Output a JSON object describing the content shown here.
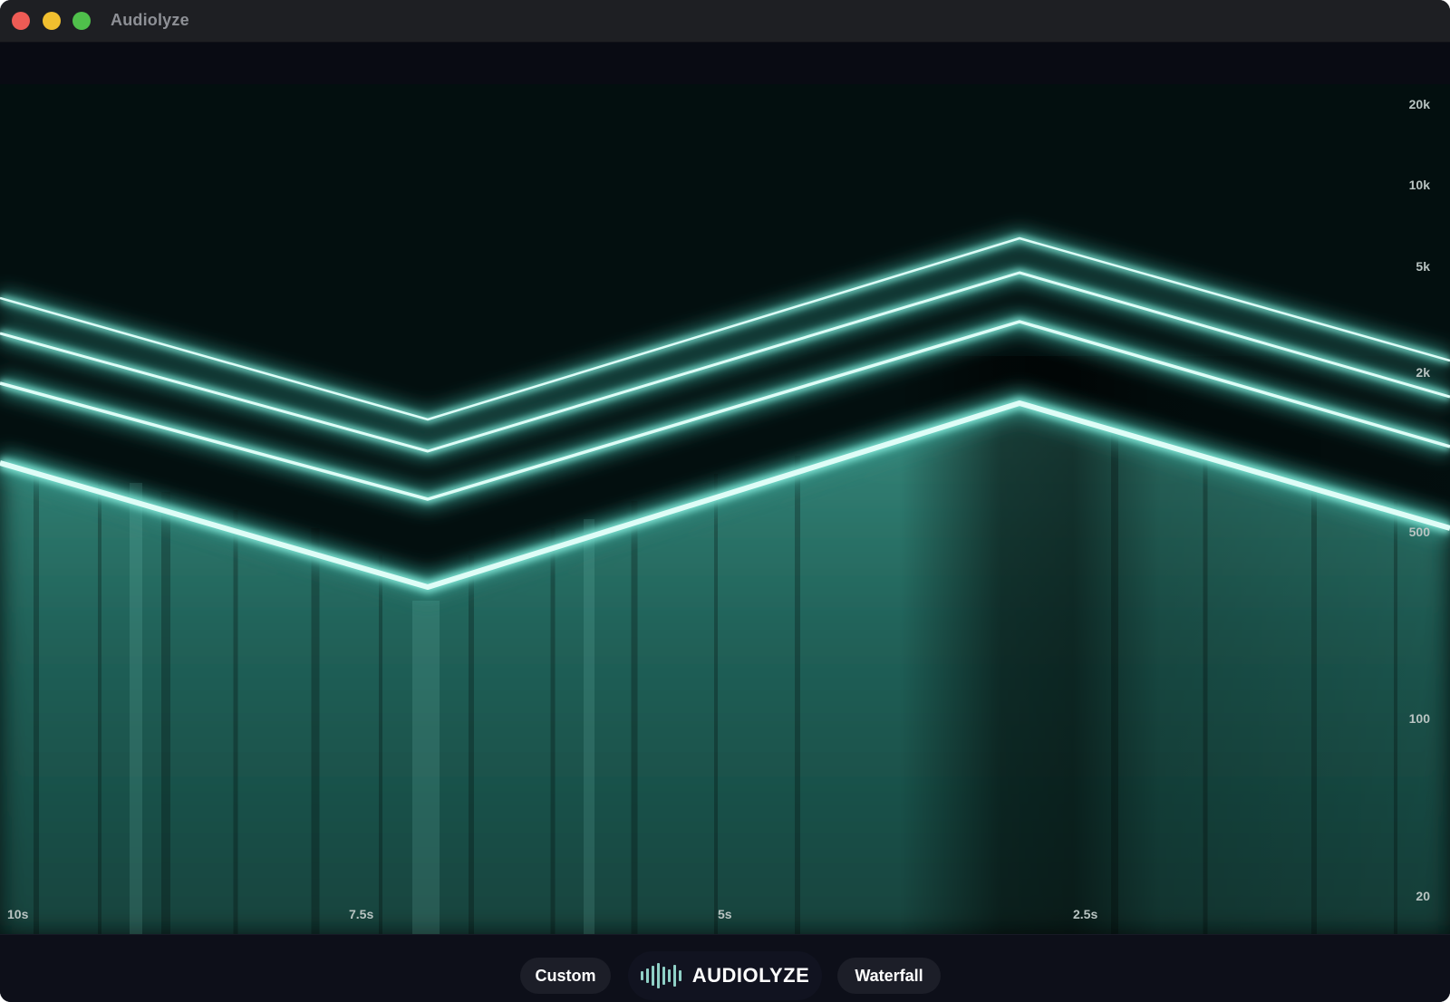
{
  "window": {
    "title": "Audiolyze"
  },
  "spectrogram": {
    "frequency_labels": [
      "20k",
      "10k",
      "5k",
      "2k",
      "500",
      "100",
      "20"
    ],
    "time_labels": [
      "10s",
      "7.5s",
      "5s",
      "2.5s"
    ],
    "accent_color": "#9ef5e6",
    "fill_color": "#2a8c7d"
  },
  "bottombar": {
    "custom_label": "Custom",
    "logo_label": "AUDIOLYZE",
    "waterfall_label": "Waterfall",
    "logo_icon": "waveform-icon"
  }
}
